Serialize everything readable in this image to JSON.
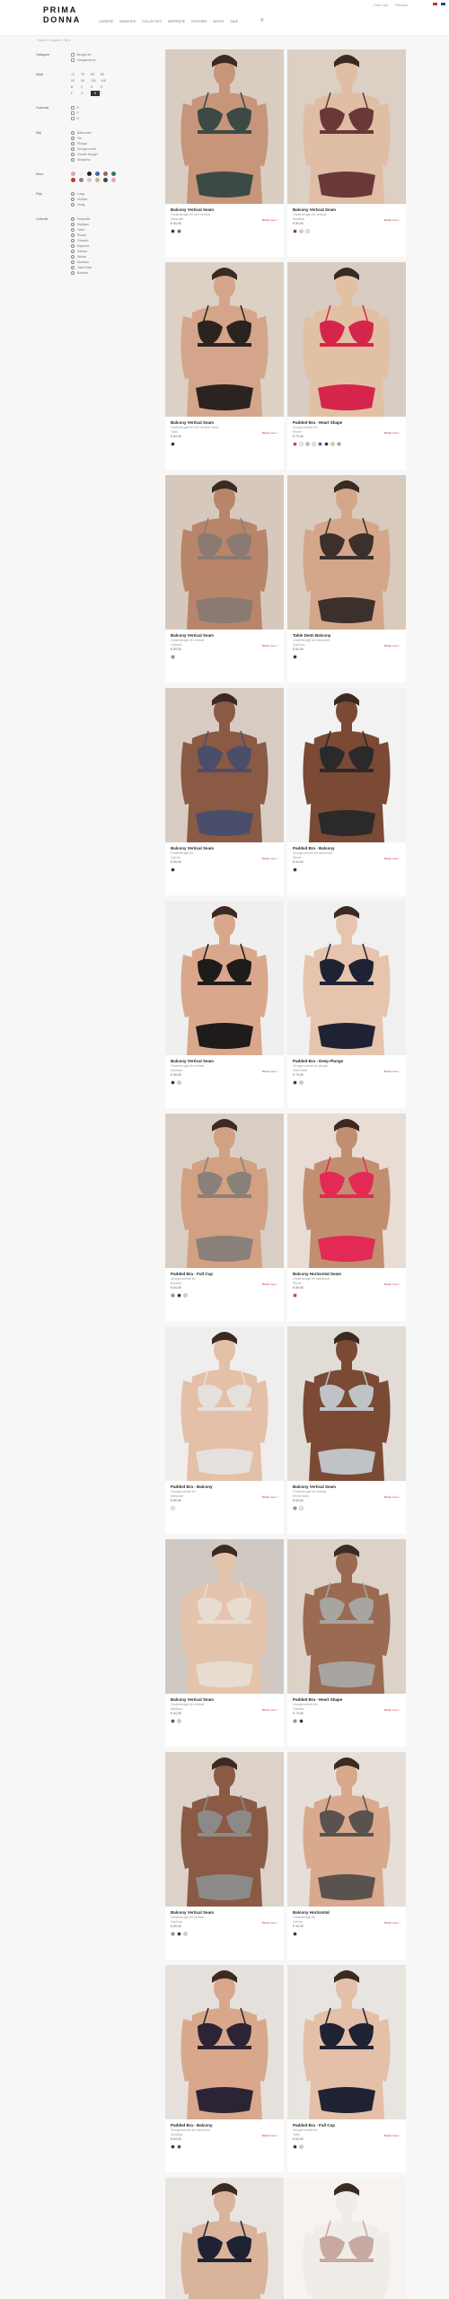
{
  "header": {
    "top_links": [
      "Over ons",
      "Winkels",
      "NL"
    ],
    "logo_line1": "PRIMA",
    "logo_line2": "DONNA",
    "nav": [
      "Lingerie",
      "Badmode",
      "Collecties",
      "Inspiratie",
      "Pasvorm",
      "Maten",
      "Sale"
    ],
    "search_icon": "search-icon"
  },
  "breadcrumb": "Home > Lingerie > Bh's",
  "filters": {
    "groups": [
      {
        "label": "Categorie",
        "options": [
          "Beugel-bh",
          "Voorgevormd"
        ]
      },
      {
        "label": "Maat",
        "sizes": [
          "70",
          "75",
          "80",
          "85",
          "90",
          "95",
          "100",
          "105",
          "B",
          "C",
          "D",
          "E",
          "F",
          "G",
          "H",
          "I"
        ]
      },
      {
        "label": "Cupmaat",
        "options": [
          "E",
          "F",
          "G"
        ]
      },
      {
        "label": "Stijl",
        "options": [
          "Balconnet",
          "Vol",
          "Plunge",
          "Voorgevormd",
          "Zonder beugel",
          "Strapless"
        ]
      },
      {
        "label": "Kleur",
        "colors": [
          "#d9a7a0",
          "#f4f0e8",
          "#222222",
          "#4466aa",
          "#8a6a55",
          "#3a7a4a",
          "#c0392b",
          "#888888",
          "#e8c1b5",
          "#d0b090",
          "#444444",
          "#f0a0b0"
        ]
      },
      {
        "label": "Prijs",
        "options": [
          "Laag",
          "Midden",
          "Hoog"
        ]
      },
      {
        "label": "Collectie",
        "options": [
          "Deauville",
          "Madison",
          "Twist",
          "Plume",
          "Orlando",
          "Sophora",
          "Zahran",
          "Divine",
          "Montara",
          "Twist East",
          "Boxtree"
        ]
      }
    ]
  },
  "products": [
    {
      "name": "Balcony Vertical Seam",
      "line1": "Onderbeugel bh met vertical",
      "line2": "Deauville",
      "price": "€ 94,95",
      "link": "Bekijk meer >",
      "colors": [
        "#222222",
        "#4a6a5a"
      ],
      "skin": "#c7957a",
      "bra": "#3b4a44",
      "bg": "#d9ccc0"
    },
    {
      "name": "Balcony Vertical Seam",
      "line1": "Onderbeugel bh vertical",
      "line2": "Madison",
      "price": "€ 89,95",
      "link": "Bekijk meer >",
      "colors": [
        "#6a3a3a",
        "#e8c1b5",
        "#f0e4dc"
      ],
      "skin": "#e0bda5",
      "bra": "#6a3838",
      "bg": "#dccfc4"
    },
    {
      "name": "Balcony Vertical Seam",
      "line1": "Onderbeugel bh met vertical naad",
      "line2": "Twist",
      "price": "€ 84,95",
      "link": "Bekijk meer >",
      "colors": [
        "#222222"
      ],
      "skin": "#d4a58a",
      "bra": "#2b2320",
      "bg": "#ddd0c5"
    },
    {
      "name": "Padded Bra - Heart Shape",
      "line1": "Voorgevormde bh",
      "line2": "Plume",
      "price": "€ 79,95",
      "link": "Bekijk meer >",
      "colors": [
        "#d22a4a",
        "#f4f0e8",
        "#c0b0a8",
        "#e8e8e8",
        "#3355aa",
        "#222222",
        "#e8c1b5",
        "#d09070"
      ],
      "skin": "#e2c0a4",
      "bra": "#d6254a",
      "bg": "#d8ccc3"
    },
    {
      "name": "Balcony Vertical Seam",
      "line1": "Onderbeugel bh vertical",
      "line2": "Orlando",
      "price": "€ 89,95",
      "link": "Bekijk meer >",
      "colors": [
        "#888888"
      ],
      "skin": "#b8856b",
      "bra": "#8a7a72",
      "bg": "#d6c8bc"
    },
    {
      "name": "Table Demi Balcony",
      "line1": "Onderbeugel bh balconnet",
      "line2": "Sophora",
      "price": "€ 84,95",
      "link": "Bekijk meer >",
      "colors": [
        "#222222"
      ],
      "skin": "#d4a68a",
      "bra": "#3b302c",
      "bg": "#d8cbbe"
    },
    {
      "name": "Balcony Vertical Seam",
      "line1": "Onderbeugel bh",
      "line2": "Zahran",
      "price": "€ 89,95",
      "link": "Bekijk meer >",
      "colors": [
        "#222222"
      ],
      "skin": "#8a5a45",
      "bra": "#4a4e6a",
      "bg": "#d8ccc2"
    },
    {
      "name": "Padded Bra - Balcony",
      "line1": "Voorgevormde bh balconnet",
      "line2": "Divine",
      "price": "€ 94,95",
      "link": "Bekijk meer >",
      "colors": [
        "#222222"
      ],
      "skin": "#7a4a35",
      "bra": "#2a2a2a",
      "bg": "#f2f2f2"
    },
    {
      "name": "Balcony Vertical Seam",
      "line1": "Onderbeugel bh vertical",
      "line2": "Montara",
      "price": "€ 99,95",
      "link": "Bekijk meer >",
      "colors": [
        "#222222",
        "#e8c1b5"
      ],
      "skin": "#d9a88c",
      "bra": "#1f1b1a",
      "bg": "#efefef"
    },
    {
      "name": "Padded Bra - Deep Plunge",
      "line1": "Voorgevormde bh plunge",
      "line2": "Twist East",
      "price": "€ 79,95",
      "link": "Bekijk meer >",
      "colors": [
        "#222233",
        "#e8c1b5"
      ],
      "skin": "#e6c4ad",
      "bra": "#1f2233",
      "bg": "#f0f0f0"
    },
    {
      "name": "Padded Bra - Full Cup",
      "line1": "Voorgevormde bh",
      "line2": "Boxtree",
      "price": "€ 84,95",
      "link": "Bekijk meer >",
      "colors": [
        "#888888",
        "#222222",
        "#e8c1b5"
      ],
      "skin": "#d2a083",
      "bra": "#8a807a",
      "bg": "#d9cec4"
    },
    {
      "name": "Balcony Horizontal Seam",
      "line1": "Onderbeugel bh balconnet",
      "line2": "Plume",
      "price": "€ 89,95",
      "link": "Bekijk meer >",
      "colors": [
        "#d22a4a"
      ],
      "skin": "#c28e70",
      "bra": "#e22a55",
      "bg": "#e8dcd4"
    },
    {
      "name": "Padded Bra - Balcony",
      "line1": "Voorgevormde bh",
      "line2": "Deauville",
      "price": "€ 89,95",
      "link": "Bekijk meer >",
      "colors": [
        "#f4e0e4"
      ],
      "skin": "#e4c0a8",
      "bra": "#e6e0dc",
      "bg": "#f0eeec"
    },
    {
      "name": "Balcony Vertical Seam",
      "line1": "Onderbeugel bh vertical",
      "line2": "Divine East",
      "price": "€ 89,95",
      "link": "Bekijk meer >",
      "colors": [
        "#888888",
        "#f0e4dc"
      ],
      "skin": "#7a4a35",
      "bra": "#bfc3c6",
      "bg": "#e2dcd6"
    },
    {
      "name": "Balcony Vertical Seam",
      "line1": "Onderbeugel bh vertical",
      "line2": "Madison",
      "price": "€ 94,95",
      "link": "Bekijk meer >",
      "colors": [
        "#6a3a3a",
        "#e8c1b5"
      ],
      "skin": "#e4c4ad",
      "bra": "#e8dcd0",
      "bg": "#d0c8c2"
    },
    {
      "name": "Padded Bra - Heart Shape",
      "line1": "Voorgevormde bh",
      "line2": "Orlando",
      "price": "€ 79,95",
      "link": "Bekijk meer >",
      "colors": [
        "#888888",
        "#222222"
      ],
      "skin": "#9a6a52",
      "bra": "#a8a4a0",
      "bg": "#dcd2c8"
    },
    {
      "name": "Balcony Vertical Seam",
      "line1": "Onderbeugel bh vertical",
      "line2": "Sophora",
      "price": "€ 89,95",
      "link": "Bekijk meer >",
      "colors": [
        "#888888",
        "#222222",
        "#e8c1b5"
      ],
      "skin": "#8a5a45",
      "bra": "#8c8a88",
      "bg": "#dcd2c8"
    },
    {
      "name": "Balcony Horizontal",
      "line1": "Onderbeugel bh",
      "line2": "Zahran",
      "price": "€ 94,95",
      "link": "Bekijk meer >",
      "colors": [
        "#222222"
      ],
      "skin": "#d8a98c",
      "bra": "#5a524e",
      "bg": "#e6dfd8"
    },
    {
      "name": "Padded Bra - Balcony",
      "line1": "Voorgevormde bh balconnet",
      "line2": "Montara",
      "price": "€ 84,95",
      "link": "Bekijk meer >",
      "colors": [
        "#222222",
        "#4a3a6a"
      ],
      "skin": "#d9a88c",
      "bra": "#2c2434",
      "bg": "#e6e0dc"
    },
    {
      "name": "Padded Bra - Full Cup",
      "line1": "Voorgevormde bh",
      "line2": "Twist",
      "price": "€ 84,95",
      "link": "Bekijk meer >",
      "colors": [
        "#222233",
        "#e8c1b5"
      ],
      "skin": "#e4c0a8",
      "bra": "#1f2233",
      "bg": "#e8e4e0"
    },
    {
      "name": "",
      "line1": "",
      "line2": "",
      "price": "",
      "link": "",
      "colors": [],
      "skin": "#d9b39a",
      "bra": "#1f2233",
      "bg": "#e8e4e0"
    },
    {
      "name": "",
      "line1": "",
      "line2": "",
      "price": "",
      "link": "",
      "colors": [],
      "skin": "#f0ece8",
      "bra": "#c8a8a0",
      "bg": "#f6f3f0"
    }
  ]
}
